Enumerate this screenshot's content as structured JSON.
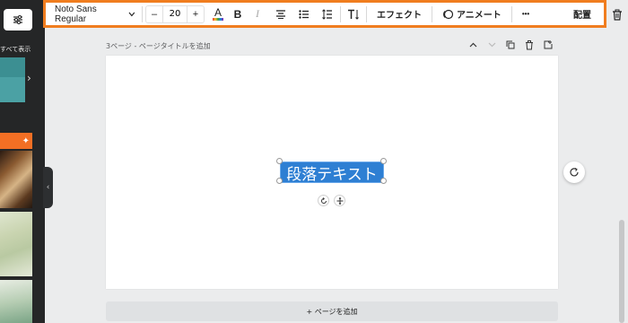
{
  "sidebar": {
    "see_all": "すべて表示",
    "filter_icon": "sliders-icon",
    "orange_icon": "sparkle-icon"
  },
  "toolbar": {
    "font_name": "Noto Sans Regular",
    "font_size": "20",
    "minus_label": "–",
    "plus_label": "+",
    "color_letter": "A",
    "bold_label": "B",
    "italic_label": "I",
    "effects_label": "エフェクト",
    "animate_label": "アニメート",
    "more_label": "•••",
    "arrange_label": "配置",
    "accent_color": "#f07d1f"
  },
  "page": {
    "title": "3ページ - ページタイトルを追加",
    "add_page_label": "+ ページを追加"
  },
  "canvas": {
    "text": "段落テキスト",
    "selection_color": "#2e7fd3"
  }
}
